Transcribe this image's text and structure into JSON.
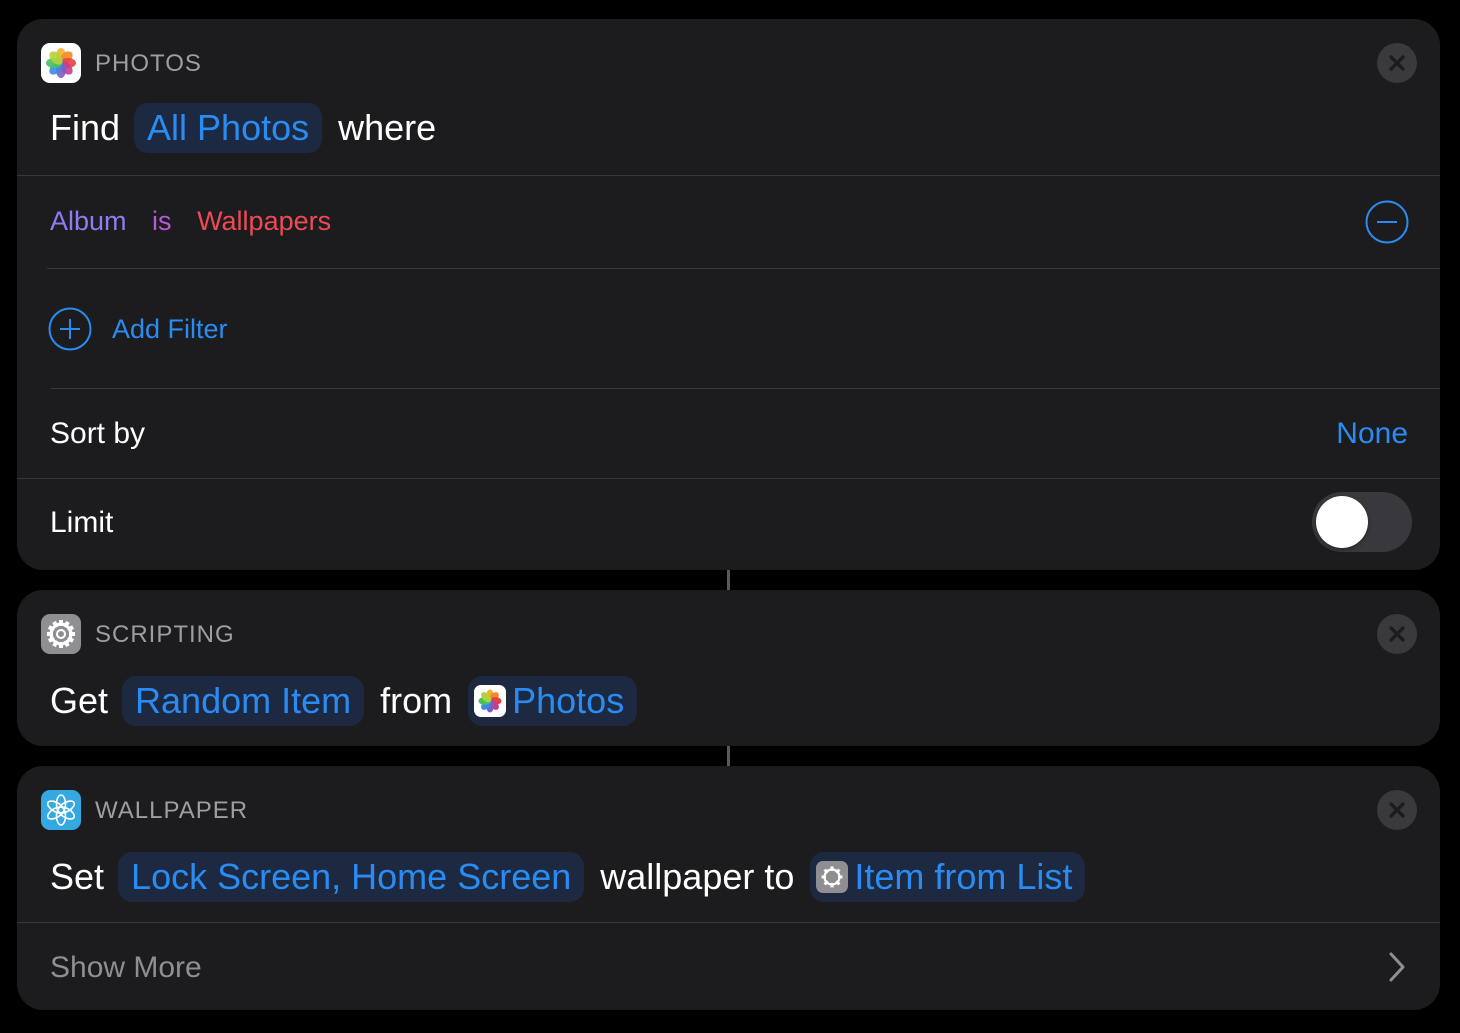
{
  "photos_action": {
    "app_label": "PHOTOS",
    "icon": "photos-icon",
    "find_word": "Find",
    "find_token": "All Photos",
    "where_word": "where",
    "filter": {
      "field": "Album",
      "op": "is",
      "value": "Wallpapers"
    },
    "add_filter_label": "Add Filter",
    "sort_label": "Sort by",
    "sort_value": "None",
    "limit_label": "Limit",
    "limit_enabled": false
  },
  "scripting_action": {
    "app_label": "SCRIPTING",
    "icon": "gear-icon",
    "get_word": "Get",
    "item_token": "Random Item",
    "from_word": "from",
    "source_token": "Photos"
  },
  "wallpaper_action": {
    "app_label": "WALLPAPER",
    "icon": "wallpaper-flower-icon",
    "set_word": "Set",
    "screens_token": "Lock Screen, Home Screen",
    "middle_words": "wallpaper to",
    "input_token": "Item from List",
    "show_more_label": "Show More"
  },
  "colors": {
    "accent": "#2a8cf2",
    "card_bg": "#1c1c1e",
    "filter_field": "#8e7cf0",
    "filter_op": "#b65ad8",
    "filter_value": "#ee4a55"
  }
}
